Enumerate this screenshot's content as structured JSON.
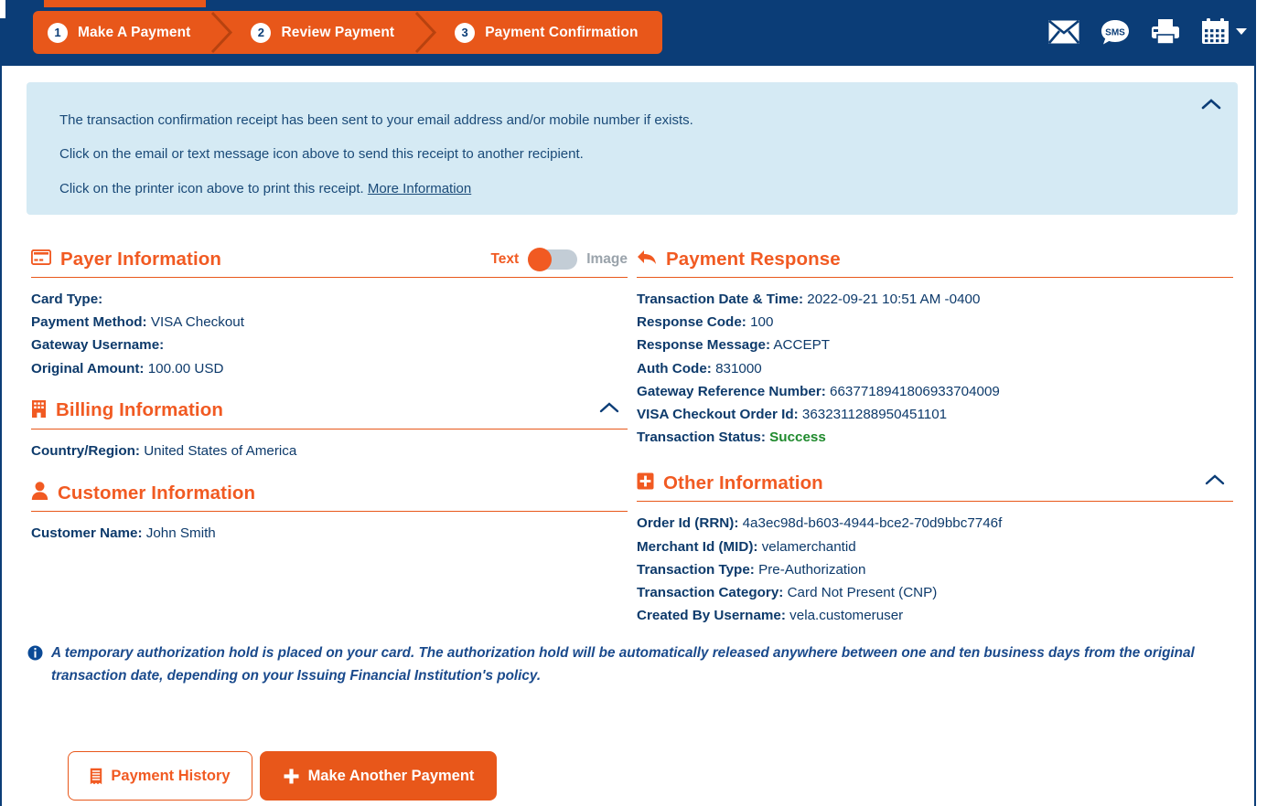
{
  "colors": {
    "navy": "#0b3d77",
    "orange": "#e8571a",
    "orange_text": "#f15a22",
    "banner_bg": "#d5eaf4",
    "success_green": "#1f8a2d",
    "body_text": "#0d3a6b"
  },
  "header": {
    "steps": [
      {
        "num": "1",
        "label": "Make A Payment"
      },
      {
        "num": "2",
        "label": "Review Payment"
      },
      {
        "num": "3",
        "label": "Payment Confirmation"
      }
    ],
    "icons": [
      {
        "name": "email-icon",
        "glyph": "envelope"
      },
      {
        "name": "sms-icon",
        "glyph": "sms-bubble",
        "text": "SMS"
      },
      {
        "name": "print-icon",
        "glyph": "printer"
      },
      {
        "name": "calendar-icon",
        "glyph": "calendar"
      }
    ]
  },
  "banner": {
    "line1": "The transaction confirmation receipt has been sent to your email address and/or mobile number if exists.",
    "line2": "Click on the email or text message icon above to send this receipt to another recipient.",
    "line3_prefix": "Click on the printer icon above to print this receipt. ",
    "more_info_link": "More Information",
    "collapse_icon": "chevron-up-icon"
  },
  "payer": {
    "title": "Payer Information",
    "icon": "credit-card-icon",
    "toggle": {
      "left_label": "Text",
      "right_label": "Image",
      "selected": "Text"
    },
    "fields": [
      {
        "label": "Card Type:",
        "value": ""
      },
      {
        "label": "Payment Method:",
        "value": "VISA Checkout"
      },
      {
        "label": "Gateway Username:",
        "value": ""
      },
      {
        "label": "Original Amount:",
        "value": "100.00 USD"
      }
    ]
  },
  "billing": {
    "title": "Billing Information",
    "icon": "building-icon",
    "collapse_icon": "chevron-up-icon",
    "fields": [
      {
        "label": "Country/Region:",
        "value": "United States of America"
      }
    ]
  },
  "customer": {
    "title": "Customer Information",
    "icon": "user-icon",
    "fields": [
      {
        "label": "Customer Name:",
        "value": "John Smith"
      }
    ]
  },
  "payment_response": {
    "title": "Payment Response",
    "icon": "reply-arrow-icon",
    "fields": [
      {
        "label": "Transaction Date & Time:",
        "value": "2022-09-21 10:51 AM -0400"
      },
      {
        "label": "Response Code:",
        "value": "100"
      },
      {
        "label": "Response Message:",
        "value": "ACCEPT"
      },
      {
        "label": "Auth Code:",
        "value": "831000"
      },
      {
        "label": "Gateway Reference Number:",
        "value": "6637718941806933704009"
      },
      {
        "label": "VISA Checkout Order Id:",
        "value": "3632311288950451101"
      },
      {
        "label": "Transaction Status:",
        "value": "Success",
        "status": true
      }
    ]
  },
  "other_information": {
    "title": "Other Information",
    "icon": "plus-square-icon",
    "collapse_icon": "chevron-up-icon",
    "fields": [
      {
        "label": "Order Id (RRN):",
        "value": "4a3ec98d-b603-4944-bce2-70d9bbc7746f"
      },
      {
        "label": "Merchant Id (MID):",
        "value": "velamerchantid"
      },
      {
        "label": "Transaction Type:",
        "value": "Pre-Authorization"
      },
      {
        "label": "Transaction Category:",
        "value": "Card Not Present (CNP)"
      },
      {
        "label": "Created By Username:",
        "value": "vela.customeruser"
      }
    ]
  },
  "disclaimer": {
    "icon": "info-circle-icon",
    "text": "A temporary authorization hold is placed on your card. The authorization hold will be automatically released anywhere between one and ten business days from the original transaction date, depending on your Issuing Financial Institution's policy."
  },
  "buttons": {
    "payment_history": {
      "label": "Payment History",
      "icon": "receipt-icon"
    },
    "make_another_payment": {
      "label": "Make Another Payment",
      "icon": "plus-icon"
    }
  }
}
